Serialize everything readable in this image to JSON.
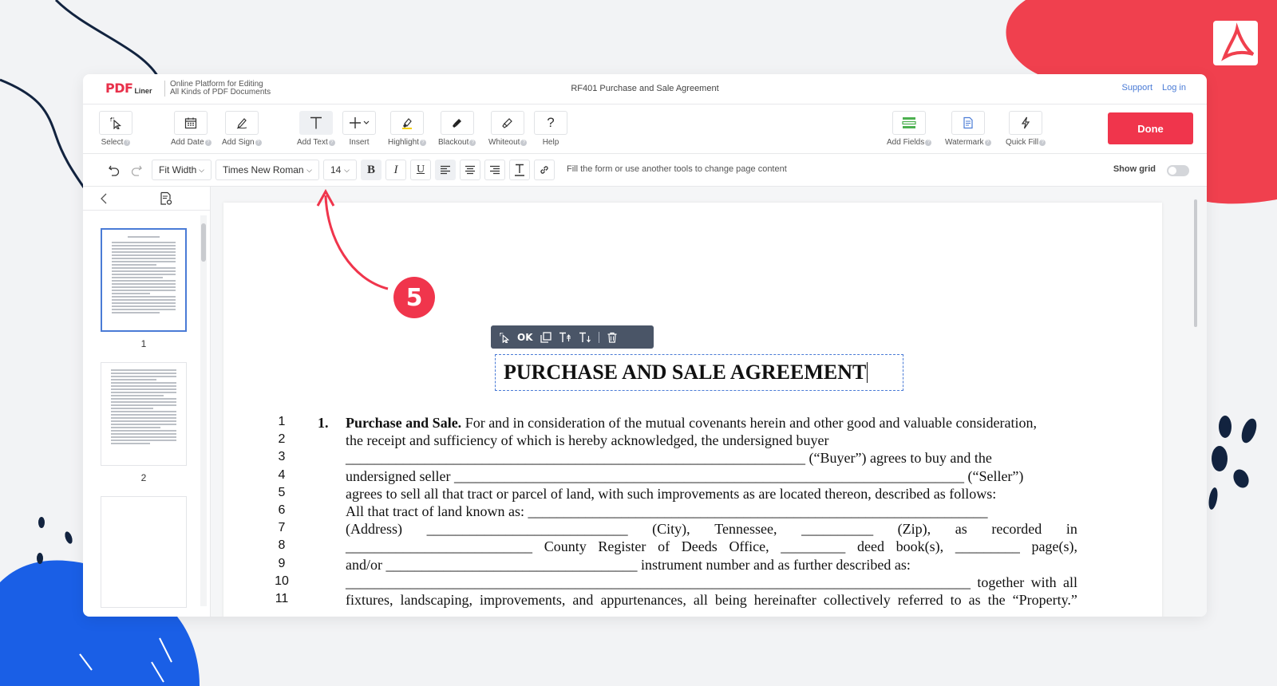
{
  "header": {
    "logo_pdf": "PDF",
    "logo_liner": "Liner",
    "tagline_line1": "Online Platform for Editing",
    "tagline_line2": "All Kinds of PDF Documents",
    "doc_title": "RF401 Purchase and Sale Agreement",
    "support": "Support",
    "login": "Log in"
  },
  "toolbar": {
    "select": "Select",
    "add_date": "Add Date",
    "add_sign": "Add Sign",
    "add_text": "Add Text",
    "insert": "Insert",
    "highlight": "Highlight",
    "blackout": "Blackout",
    "whiteout": "Whiteout",
    "help": "Help",
    "add_fields": "Add Fields",
    "watermark": "Watermark",
    "quick_fill": "Quick Fill",
    "done": "Done"
  },
  "format": {
    "zoom": "Fit Width",
    "font": "Times New Roman",
    "size": "14",
    "bold": "B",
    "italic": "I",
    "underline": "U",
    "hint": "Fill the form or use another tools to change page content",
    "show_grid": "Show grid"
  },
  "sidebar": {
    "pages": [
      "1",
      "2"
    ]
  },
  "floating_toolbar": {
    "ok": "OK"
  },
  "document": {
    "title": "PURCHASE AND SALE AGREEMENT",
    "section_number": "1.",
    "lines": [
      {
        "n": "1",
        "t": [
          "Purchase and Sale.  For and in consideration of the mutual covenants herein and other good and valuable consideration,"
        ]
      },
      {
        "n": "2",
        "t": [
          "the receipt and sufficiency of which is hereby acknowledged, the undersigned buyer"
        ]
      },
      {
        "n": "3",
        "t": [
          "________________________________________________________________ (“Buyer”) agrees to buy and the"
        ]
      },
      {
        "n": "4",
        "t": [
          "undersigned seller _______________________________________________________________________ (“Seller”)"
        ]
      },
      {
        "n": "5",
        "t": [
          "agrees to sell all that tract or parcel of land, with such improvements as are located thereon, described as follows:"
        ]
      },
      {
        "n": "6",
        "t": [
          "All that tract of land known as: ________________________________________________________________"
        ]
      },
      {
        "n": "7",
        "t": [
          "(Address)",
          "____________________________",
          "(City),",
          "Tennessee,",
          "__________",
          "(Zip),",
          "as",
          "recorded",
          "in"
        ]
      },
      {
        "n": "8",
        "t": [
          "__________________________",
          "County",
          "Register",
          "of",
          "Deeds",
          "Office,",
          "_________",
          "deed",
          "book(s),",
          "_________",
          "page(s),"
        ]
      },
      {
        "n": "9",
        "t": [
          "and/or ___________________________________ instrument number and as further described as:"
        ]
      },
      {
        "n": "10",
        "t": [
          "_______________________________________________________________________________________",
          "together",
          "with",
          "all"
        ]
      },
      {
        "n": "11",
        "t": [
          "fixtures,",
          "landscaping,",
          "improvements,",
          "and",
          "appurtenances,",
          "all",
          "being",
          "hereinafter",
          "collectively",
          "referred",
          "to",
          "as",
          "the",
          "“Property.”"
        ]
      }
    ]
  },
  "annotation": {
    "step": "5"
  },
  "colors": {
    "brand_red": "#f0354c",
    "accent_blue": "#4a7bd6",
    "deco_blue": "#1a5fe6",
    "deco_navy": "#12233f"
  }
}
